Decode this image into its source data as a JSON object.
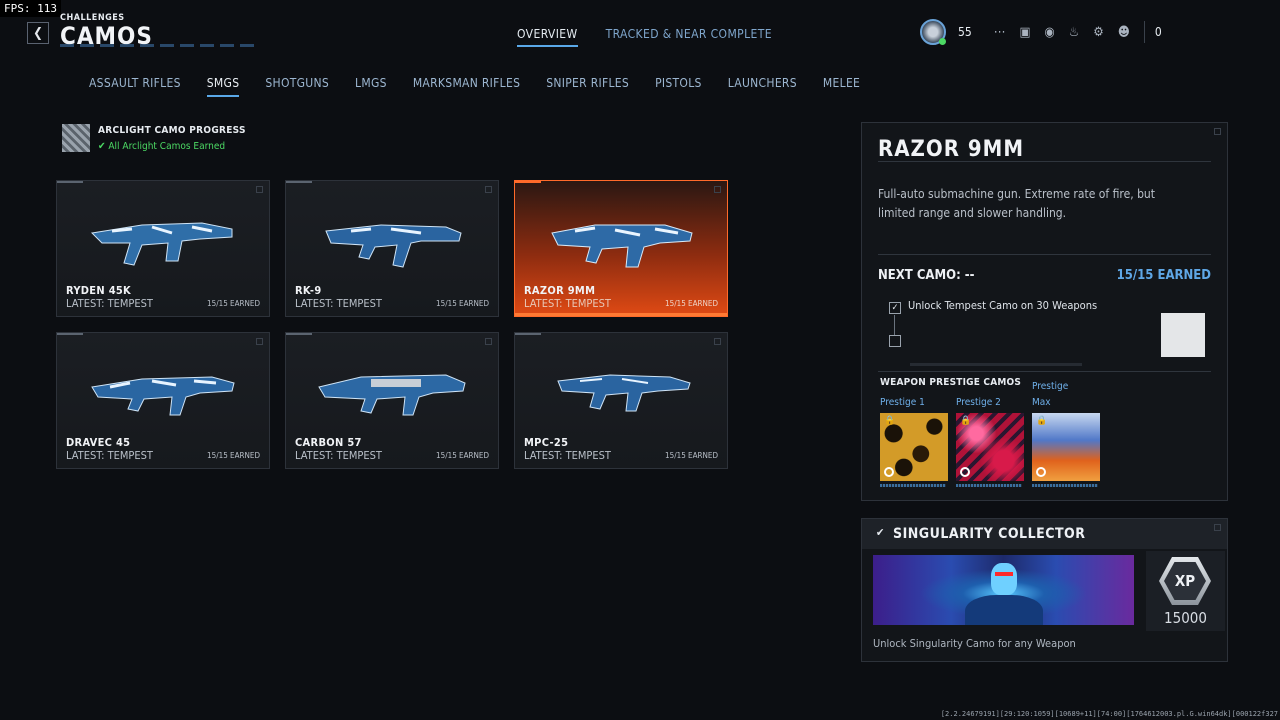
{
  "fps": "FPS: 113",
  "header": {
    "breadcrumb": "CHALLENGES",
    "title": "CAMOS",
    "tabs": [
      {
        "label": "OVERVIEW",
        "active": true
      },
      {
        "label": "TRACKED & NEAR COMPLETE",
        "active": false
      }
    ],
    "level": "55",
    "currency": "0"
  },
  "categories": [
    {
      "label": "ASSAULT RIFLES",
      "active": false
    },
    {
      "label": "SMGS",
      "active": true
    },
    {
      "label": "SHOTGUNS",
      "active": false
    },
    {
      "label": "LMGS",
      "active": false
    },
    {
      "label": "MARKSMAN RIFLES",
      "active": false
    },
    {
      "label": "SNIPER RIFLES",
      "active": false
    },
    {
      "label": "PISTOLS",
      "active": false
    },
    {
      "label": "LAUNCHERS",
      "active": false
    },
    {
      "label": "MELEE",
      "active": false
    }
  ],
  "progress": {
    "title": "ARCLIGHT CAMO PROGRESS",
    "status": "All Arclight Camos Earned"
  },
  "weapons": [
    {
      "name": "RYDEN 45K",
      "latest": "LATEST: TEMPEST",
      "earned": "15/15 EARNED",
      "selected": false
    },
    {
      "name": "RK-9",
      "latest": "LATEST: TEMPEST",
      "earned": "15/15 EARNED",
      "selected": false
    },
    {
      "name": "RAZOR 9MM",
      "latest": "LATEST: TEMPEST",
      "earned": "15/15 EARNED",
      "selected": true
    },
    {
      "name": "DRAVEC 45",
      "latest": "LATEST: TEMPEST",
      "earned": "15/15 EARNED",
      "selected": false
    },
    {
      "name": "CARBON 57",
      "latest": "LATEST: TEMPEST",
      "earned": "15/15 EARNED",
      "selected": false
    },
    {
      "name": "MPC-25",
      "latest": "LATEST: TEMPEST",
      "earned": "15/15 EARNED",
      "selected": false
    }
  ],
  "detail": {
    "title": "RAZOR 9MM",
    "description": "Full-auto submachine gun. Extreme rate of fire, but limited range and slower handling.",
    "next_camo": "NEXT CAMO: --",
    "earned": "15/15 EARNED",
    "challenge": "Unlock Tempest Camo on 30 Weapons",
    "prestige_title": "WEAPON PRESTIGE CAMOS",
    "prestige": [
      {
        "label": "Prestige 1"
      },
      {
        "label": "Prestige 2"
      },
      {
        "label_top": "Prestige",
        "label": "Max"
      }
    ]
  },
  "collector": {
    "title": "SINGULARITY COLLECTOR",
    "xp_badge": "XP",
    "xp_value": "15000",
    "description": "Unlock Singularity Camo for any Weapon"
  },
  "build_info": "[2.2.24679191][29:120:1059][10689+11][74:00][1764612003.pl.G.win64dk][000122f327"
}
